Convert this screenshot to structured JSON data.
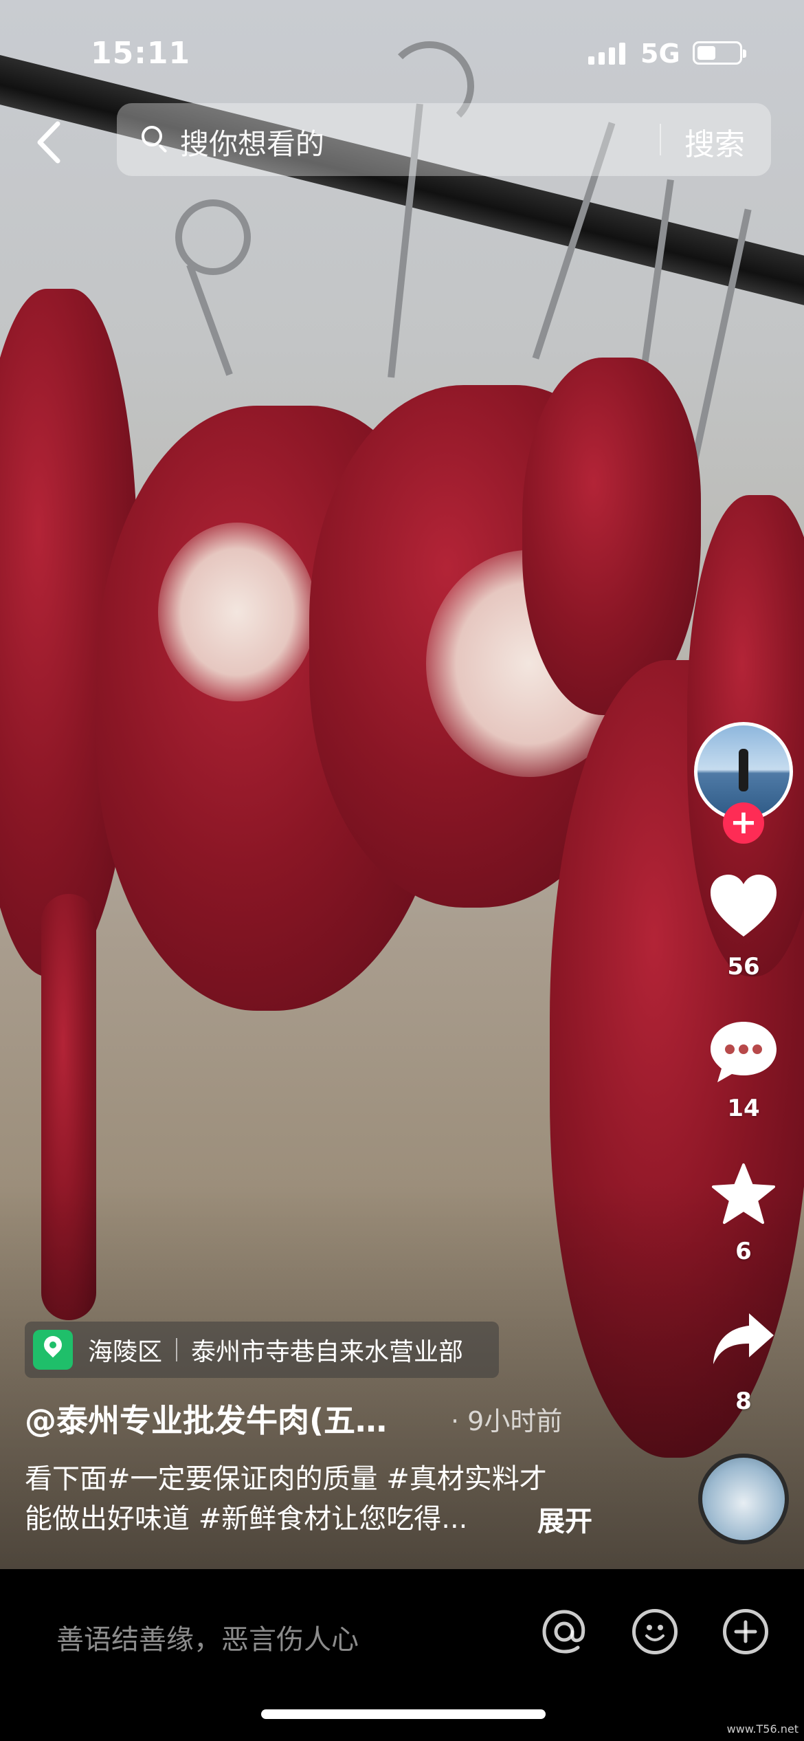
{
  "status_bar": {
    "time": "15:11",
    "network": "5G",
    "battery_level": 0.45
  },
  "search": {
    "placeholder": "搜你想看的",
    "button_label": "搜索"
  },
  "actions": {
    "likes": "56",
    "comments": "14",
    "favorites": "6",
    "shares": "8",
    "follow_symbol": "+"
  },
  "video_info": {
    "location_district": "海陵区",
    "location_place": "泰州市寺巷自来水营业部",
    "author": "@泰州专业批发牛肉(五…",
    "time_ago": "· 9小时前",
    "description_line1": "看下面#一定要保证肉的质量 #真材实料才",
    "description_line2": "能做出好味道 #新鲜食材让您吃得...",
    "expand_label": "展开"
  },
  "comment_bar": {
    "placeholder": "善语结善缘，恶言伤人心"
  },
  "watermark": "www.T56.net",
  "colors": {
    "follow_red": "#fe2c55",
    "location_green": "#1fbf6a"
  },
  "icons": [
    "back-arrow-icon",
    "search-icon",
    "heart-icon",
    "comment-icon",
    "star-icon",
    "share-icon",
    "location-pin-icon",
    "at-icon",
    "emoji-icon",
    "plus-icon"
  ]
}
